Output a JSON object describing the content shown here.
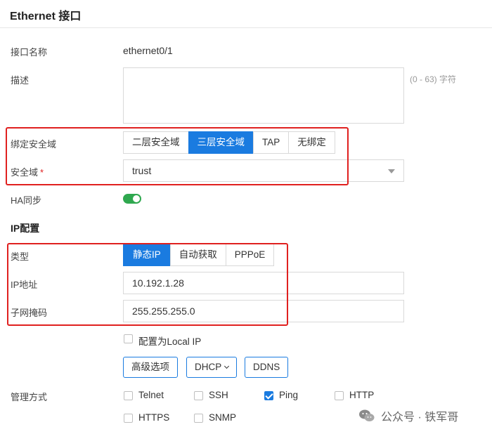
{
  "header": {
    "title": "Ethernet 接口"
  },
  "form": {
    "name_label": "接口名称",
    "name_value": "ethernet0/1",
    "desc_label": "描述",
    "desc_value": "",
    "desc_hint": "(0 - 63) 字符",
    "bind_label": "绑定安全域",
    "bind_options": [
      "二层安全域",
      "三层安全域",
      "TAP",
      "无绑定"
    ],
    "bind_selected": "三层安全域",
    "zone_label": "安全域",
    "zone_required_mark": "*",
    "zone_value": "trust",
    "ha_label": "HA同步",
    "ha_enabled": true
  },
  "ip_config": {
    "section_title": "IP配置",
    "type_label": "类型",
    "type_options": [
      "静态IP",
      "自动获取",
      "PPPoE"
    ],
    "type_selected": "静态IP",
    "ip_label": "IP地址",
    "ip_value": "10.192.1.28",
    "mask_label": "子网掩码",
    "mask_value": "255.255.255.0",
    "local_ip_label": "配置为Local IP",
    "local_ip_checked": false,
    "buttons": {
      "advanced": "高级选项",
      "dhcp": "DHCP",
      "ddns": "DDNS"
    }
  },
  "management": {
    "label": "管理方式",
    "options": [
      {
        "name": "Telnet",
        "checked": false
      },
      {
        "name": "SSH",
        "checked": false
      },
      {
        "name": "Ping",
        "checked": true
      },
      {
        "name": "HTTP",
        "checked": false
      },
      {
        "name": "HTTPS",
        "checked": false
      },
      {
        "name": "SNMP",
        "checked": false
      }
    ]
  },
  "watermark": {
    "text": "公众号 · 铁军哥"
  },
  "colors": {
    "accent": "#1a7be0",
    "highlight_box": "#e0201f",
    "toggle_on": "#2fa84f"
  }
}
